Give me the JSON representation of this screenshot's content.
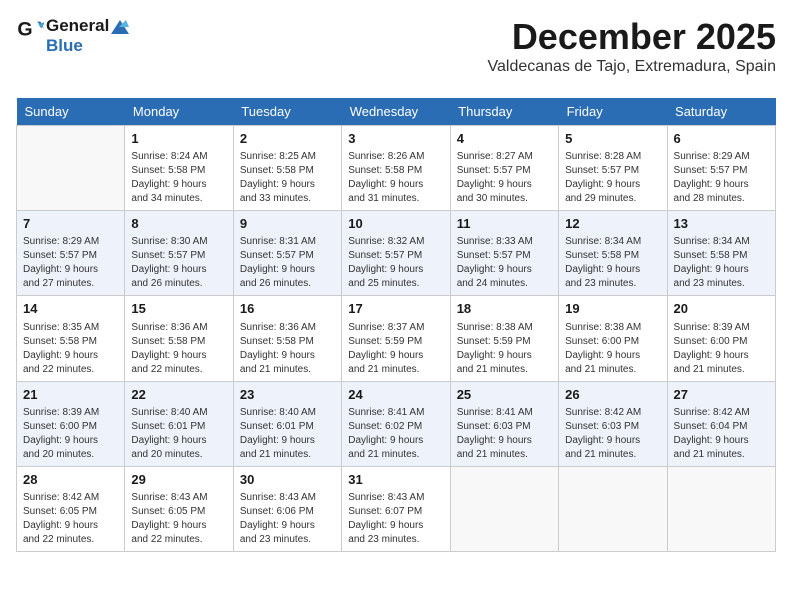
{
  "logo": {
    "line1": "General",
    "line2": "Blue"
  },
  "title": "December 2025",
  "subtitle": "Valdecanas de Tajo, Extremadura, Spain",
  "days_of_week": [
    "Sunday",
    "Monday",
    "Tuesday",
    "Wednesday",
    "Thursday",
    "Friday",
    "Saturday"
  ],
  "weeks": [
    [
      {
        "day": "",
        "info": ""
      },
      {
        "day": "1",
        "info": "Sunrise: 8:24 AM\nSunset: 5:58 PM\nDaylight: 9 hours\nand 34 minutes."
      },
      {
        "day": "2",
        "info": "Sunrise: 8:25 AM\nSunset: 5:58 PM\nDaylight: 9 hours\nand 33 minutes."
      },
      {
        "day": "3",
        "info": "Sunrise: 8:26 AM\nSunset: 5:58 PM\nDaylight: 9 hours\nand 31 minutes."
      },
      {
        "day": "4",
        "info": "Sunrise: 8:27 AM\nSunset: 5:57 PM\nDaylight: 9 hours\nand 30 minutes."
      },
      {
        "day": "5",
        "info": "Sunrise: 8:28 AM\nSunset: 5:57 PM\nDaylight: 9 hours\nand 29 minutes."
      },
      {
        "day": "6",
        "info": "Sunrise: 8:29 AM\nSunset: 5:57 PM\nDaylight: 9 hours\nand 28 minutes."
      }
    ],
    [
      {
        "day": "7",
        "info": "Sunrise: 8:29 AM\nSunset: 5:57 PM\nDaylight: 9 hours\nand 27 minutes."
      },
      {
        "day": "8",
        "info": "Sunrise: 8:30 AM\nSunset: 5:57 PM\nDaylight: 9 hours\nand 26 minutes."
      },
      {
        "day": "9",
        "info": "Sunrise: 8:31 AM\nSunset: 5:57 PM\nDaylight: 9 hours\nand 26 minutes."
      },
      {
        "day": "10",
        "info": "Sunrise: 8:32 AM\nSunset: 5:57 PM\nDaylight: 9 hours\nand 25 minutes."
      },
      {
        "day": "11",
        "info": "Sunrise: 8:33 AM\nSunset: 5:57 PM\nDaylight: 9 hours\nand 24 minutes."
      },
      {
        "day": "12",
        "info": "Sunrise: 8:34 AM\nSunset: 5:58 PM\nDaylight: 9 hours\nand 23 minutes."
      },
      {
        "day": "13",
        "info": "Sunrise: 8:34 AM\nSunset: 5:58 PM\nDaylight: 9 hours\nand 23 minutes."
      }
    ],
    [
      {
        "day": "14",
        "info": "Sunrise: 8:35 AM\nSunset: 5:58 PM\nDaylight: 9 hours\nand 22 minutes."
      },
      {
        "day": "15",
        "info": "Sunrise: 8:36 AM\nSunset: 5:58 PM\nDaylight: 9 hours\nand 22 minutes."
      },
      {
        "day": "16",
        "info": "Sunrise: 8:36 AM\nSunset: 5:58 PM\nDaylight: 9 hours\nand 21 minutes."
      },
      {
        "day": "17",
        "info": "Sunrise: 8:37 AM\nSunset: 5:59 PM\nDaylight: 9 hours\nand 21 minutes."
      },
      {
        "day": "18",
        "info": "Sunrise: 8:38 AM\nSunset: 5:59 PM\nDaylight: 9 hours\nand 21 minutes."
      },
      {
        "day": "19",
        "info": "Sunrise: 8:38 AM\nSunset: 6:00 PM\nDaylight: 9 hours\nand 21 minutes."
      },
      {
        "day": "20",
        "info": "Sunrise: 8:39 AM\nSunset: 6:00 PM\nDaylight: 9 hours\nand 21 minutes."
      }
    ],
    [
      {
        "day": "21",
        "info": "Sunrise: 8:39 AM\nSunset: 6:00 PM\nDaylight: 9 hours\nand 20 minutes."
      },
      {
        "day": "22",
        "info": "Sunrise: 8:40 AM\nSunset: 6:01 PM\nDaylight: 9 hours\nand 20 minutes."
      },
      {
        "day": "23",
        "info": "Sunrise: 8:40 AM\nSunset: 6:01 PM\nDaylight: 9 hours\nand 21 minutes."
      },
      {
        "day": "24",
        "info": "Sunrise: 8:41 AM\nSunset: 6:02 PM\nDaylight: 9 hours\nand 21 minutes."
      },
      {
        "day": "25",
        "info": "Sunrise: 8:41 AM\nSunset: 6:03 PM\nDaylight: 9 hours\nand 21 minutes."
      },
      {
        "day": "26",
        "info": "Sunrise: 8:42 AM\nSunset: 6:03 PM\nDaylight: 9 hours\nand 21 minutes."
      },
      {
        "day": "27",
        "info": "Sunrise: 8:42 AM\nSunset: 6:04 PM\nDaylight: 9 hours\nand 21 minutes."
      }
    ],
    [
      {
        "day": "28",
        "info": "Sunrise: 8:42 AM\nSunset: 6:05 PM\nDaylight: 9 hours\nand 22 minutes."
      },
      {
        "day": "29",
        "info": "Sunrise: 8:43 AM\nSunset: 6:05 PM\nDaylight: 9 hours\nand 22 minutes."
      },
      {
        "day": "30",
        "info": "Sunrise: 8:43 AM\nSunset: 6:06 PM\nDaylight: 9 hours\nand 23 minutes."
      },
      {
        "day": "31",
        "info": "Sunrise: 8:43 AM\nSunset: 6:07 PM\nDaylight: 9 hours\nand 23 minutes."
      },
      {
        "day": "",
        "info": ""
      },
      {
        "day": "",
        "info": ""
      },
      {
        "day": "",
        "info": ""
      }
    ]
  ]
}
